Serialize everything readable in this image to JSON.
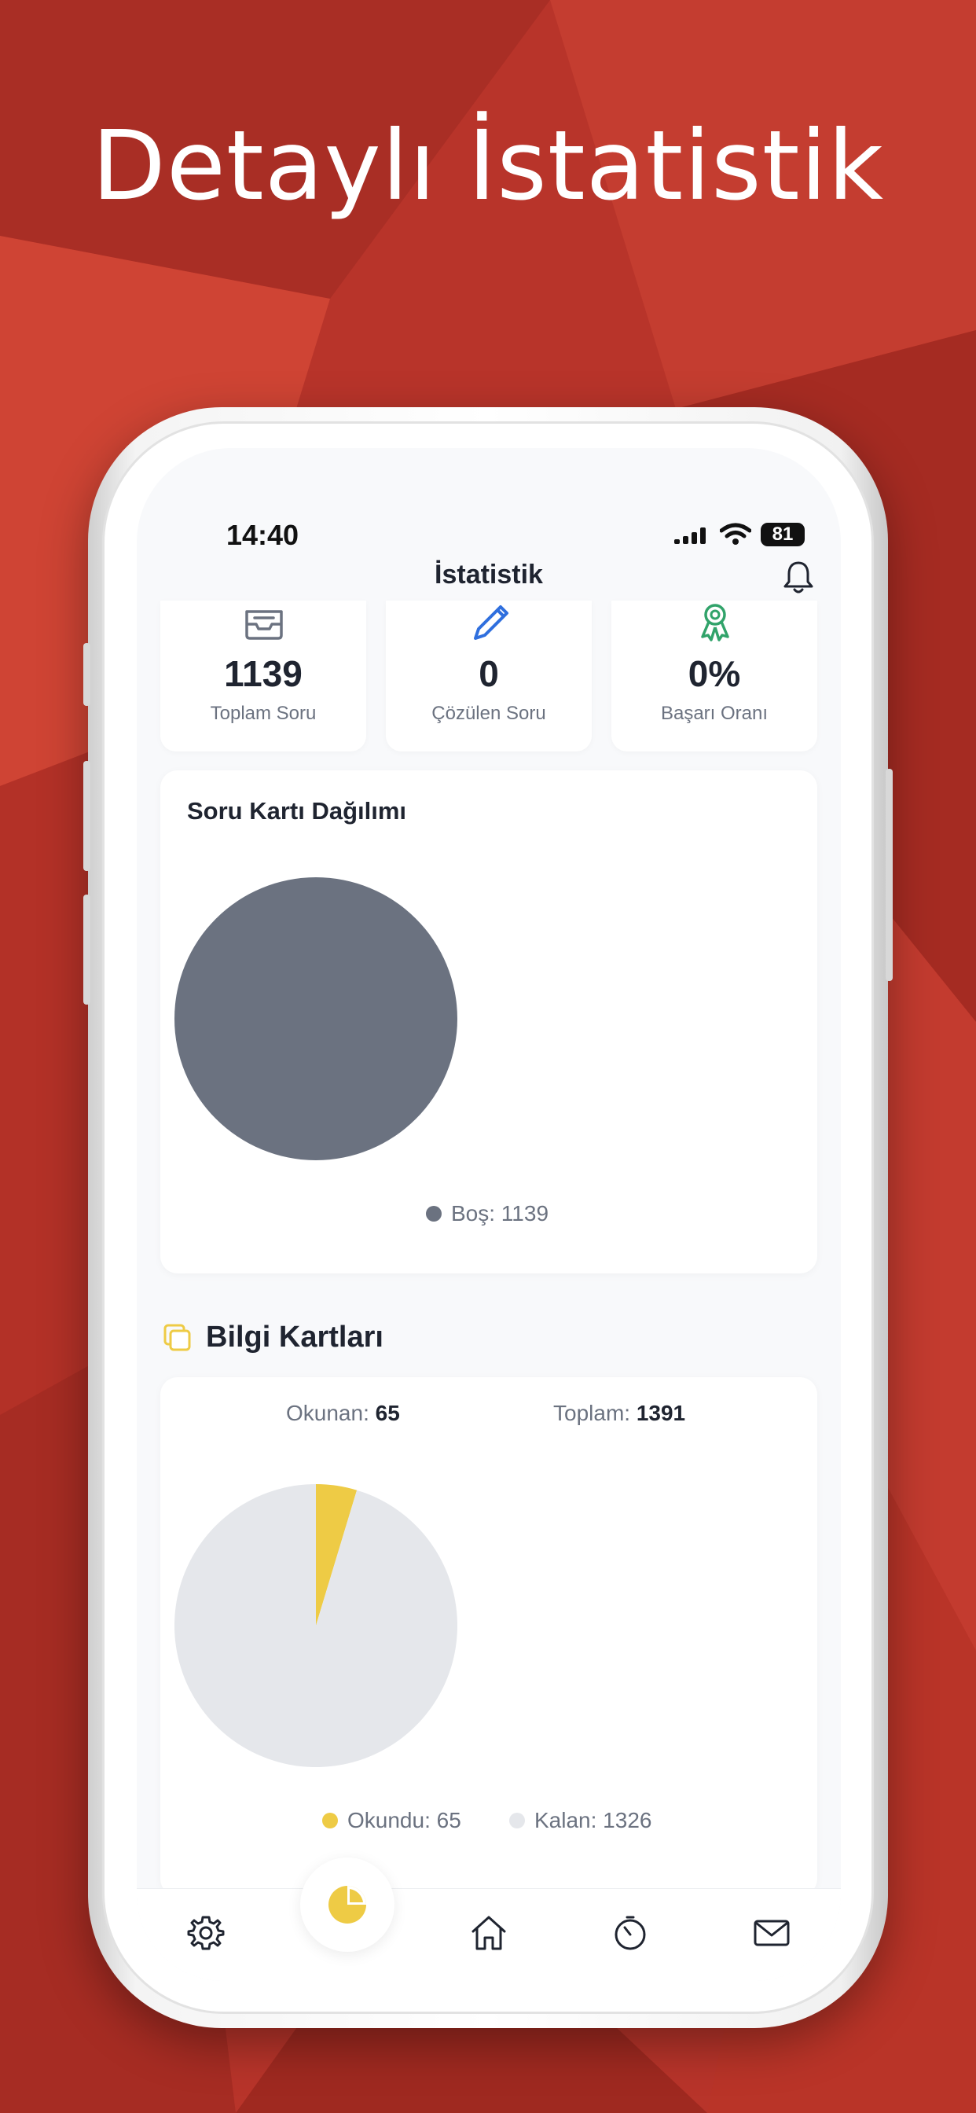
{
  "headline": "Detaylı İstatistik",
  "status_bar": {
    "time": "14:40",
    "battery": "81"
  },
  "nav": {
    "title": "İstatistik",
    "bell_icon": "bell-icon"
  },
  "stats": [
    {
      "icon": "inbox-icon",
      "value": "1139",
      "label": "Toplam Soru"
    },
    {
      "icon": "pencil-icon",
      "value": "0",
      "label": "Çözülen Soru"
    },
    {
      "icon": "award-ribbon-icon",
      "value": "0%",
      "label": "Başarı Oranı"
    }
  ],
  "question_card": {
    "title": "Soru Kartı Dağılımı",
    "legend": "Boş: 1139"
  },
  "info_section": {
    "title": "Bilgi Kartları",
    "icon": "cards-icon"
  },
  "info_card": {
    "read_label": "Okunan:",
    "read_value": "65",
    "total_label": "Toplam:",
    "total_value": "1391",
    "legend_read": "Okundu: 65",
    "legend_remaining": "Kalan: 1326"
  },
  "colors": {
    "background": "#b9352a",
    "pie_empty": "#6b7280",
    "pie_read": "#eecb45",
    "pie_remaining": "#e5e7eb",
    "pencil": "#2f6fde",
    "award": "#31a36a"
  },
  "tabs": [
    {
      "icon": "settings-gear-icon"
    },
    {
      "icon": "pie-chart-icon",
      "active": true
    },
    {
      "icon": "home-icon"
    },
    {
      "icon": "timer-icon"
    },
    {
      "icon": "mail-icon"
    }
  ],
  "chart_data": [
    {
      "type": "pie",
      "categories": [
        "Boş"
      ],
      "values": [
        1139
      ],
      "title": "Soru Kartı Dağılımı",
      "legend_placement": "bottom"
    },
    {
      "type": "pie",
      "categories": [
        "Okundu",
        "Kalan"
      ],
      "values": [
        65,
        1326
      ],
      "title": "",
      "legend_placement": "bottom"
    }
  ]
}
